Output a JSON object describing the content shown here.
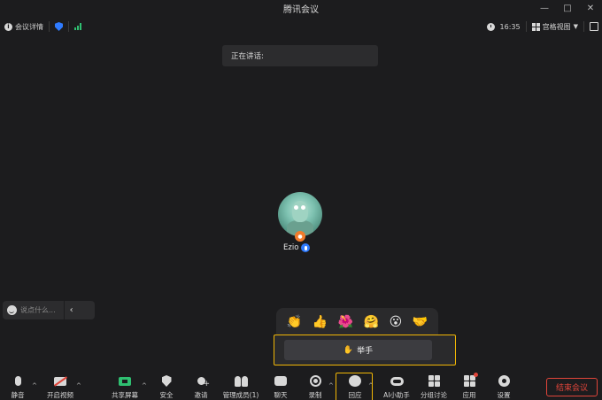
{
  "window": {
    "title": "腾讯会议",
    "controls": [
      "—",
      "□",
      "✕"
    ]
  },
  "topbar": {
    "meeting_details": "会议详情",
    "time": "16:35",
    "view_mode": "宫格视图"
  },
  "speaking": {
    "label": "正在讲话:"
  },
  "participant": {
    "name": "Ezio"
  },
  "chat": {
    "placeholder": "说点什么..."
  },
  "reactions": {
    "emojis": [
      "👏",
      "👍",
      "🌺",
      "🤗",
      "😮",
      "🤝"
    ],
    "raise_hand_icon": "✋",
    "raise_hand_label": "举手"
  },
  "toolbar": {
    "mute": "静音",
    "video": "开启视频",
    "share": "共享屏幕",
    "security": "安全",
    "invite": "邀请",
    "members": "管理成员(1)",
    "chat": "聊天",
    "record": "录制",
    "react": "回应",
    "ai": "AI小助手",
    "breakout": "分组讨论",
    "apps": "应用",
    "settings": "设置",
    "end": "结束会议"
  },
  "colors": {
    "accent_blue": "#2f7bff",
    "highlight": "#f2b705",
    "danger": "#e0453a",
    "ok_green": "#2fbf71"
  }
}
